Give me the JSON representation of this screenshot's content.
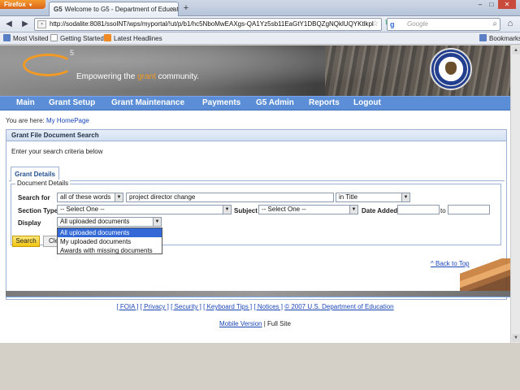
{
  "browser": {
    "app_button": "Firefox",
    "tab_title": "Welcome to G5 - Department of Educatio...",
    "tab_favicon_text": "G5",
    "new_tab": "+",
    "url": "http://sodalite:8081/ssoINT/wps/myportal/!ut/p/b1/hc5NboMwEAXgs-QA1Yz5sb11EaGtY1DBQZgNQklUQYKtlkpl",
    "search_placeholder": "Google",
    "bookmarks": [
      "Most Visited",
      "Getting Started",
      "Latest Headlines"
    ],
    "bookmarks_menu": "Bookmarks"
  },
  "banner": {
    "logo_text": "G",
    "logo_sup": "5",
    "tagline_prefix": "Empowering the ",
    "tagline_highlight": "grant",
    "tagline_suffix": " community.",
    "seal_text": "DEPARTMENT OF EDUCATION"
  },
  "main_nav": [
    "Main",
    "Grant Setup",
    "Grant Maintenance",
    "Payments",
    "G5 Admin",
    "Reports",
    "Logout"
  ],
  "breadcrumb": {
    "prefix": "You are here: ",
    "link": "My HomePage"
  },
  "panel": {
    "title": "Grant File Document Search",
    "instructions": "Enter your search criteria below",
    "tab": "Grant Details",
    "legend": "Document Details",
    "search_for_label": "Search for",
    "search_mode": "all of these words",
    "search_text": "project director change",
    "search_scope": "in Title",
    "section_type_label": "Section Type",
    "section_type_value": "-- Select One --",
    "subject_label": "Subject",
    "subject_value": "-- Select One --",
    "date_added_label": "Date Added",
    "date_to_label": "to",
    "date_from_value": "",
    "date_to_value": "",
    "display_label": "Display",
    "display_value": "All uploaded documents",
    "display_options": [
      "All uploaded documents",
      "My uploaded documents",
      "Awards with missing documents"
    ],
    "search_button": "Search",
    "clear_button": "Clear"
  },
  "back_to_top": "^ Back to Top",
  "footer": {
    "links": [
      "[ FOIA ]",
      "[ Privacy ]",
      "[ Security ]",
      "[ Keyboard Tips ]",
      "[ Notices ]",
      "© 2007 U.S. Department of Education"
    ],
    "mobile_link": "Mobile Version",
    "separator": " | ",
    "full_site": "Full Site"
  }
}
